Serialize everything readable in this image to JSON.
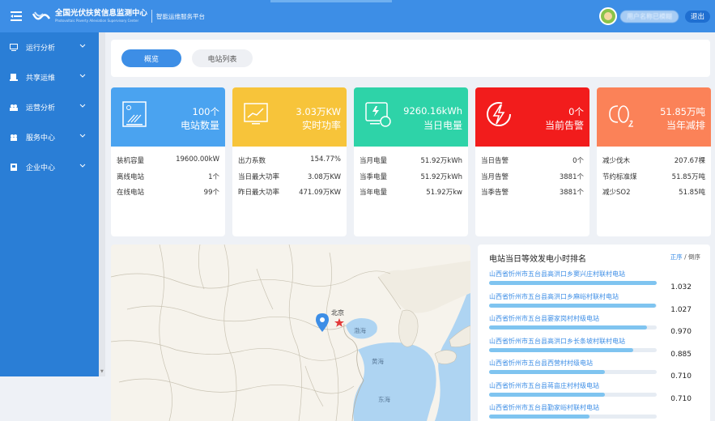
{
  "header": {
    "brand_cn": "全国光伏扶贫信息监测中心",
    "brand_en": "Photovoltaic Poverty Alleviation Supervisory Center",
    "sub_brand": "智能运维服务平台",
    "username": "用户名称已模糊",
    "logout_label": "退出"
  },
  "sidebar": {
    "items": [
      {
        "label": "运行分析",
        "icon": "monitor-icon"
      },
      {
        "label": "共享运维",
        "icon": "device-icon"
      },
      {
        "label": "运营分析",
        "icon": "group-icon"
      },
      {
        "label": "服务中心",
        "icon": "service-icon"
      },
      {
        "label": "企业中心",
        "icon": "building-icon"
      }
    ]
  },
  "tabs": [
    {
      "label": "概览",
      "active": true
    },
    {
      "label": "电站列表",
      "active": false
    }
  ],
  "cards": [
    {
      "color": "#4aa3f0",
      "icon": "solar-panel-icon",
      "value": "100个",
      "label": "电站数量",
      "rows": [
        {
          "k": "装机容量",
          "v": "19600.00kW"
        },
        {
          "k": "离线电站",
          "v": "1个"
        },
        {
          "k": "在线电站",
          "v": "99个"
        }
      ]
    },
    {
      "color": "#f7c43a",
      "icon": "line-chart-icon",
      "value": "3.03万KW",
      "label": "实时功率",
      "rows": [
        {
          "k": "出力系数",
          "v": "154.77%"
        },
        {
          "k": "当日最大功率",
          "v": "3.08万KW"
        },
        {
          "k": "昨日最大功率",
          "v": "471.09万KW"
        }
      ]
    },
    {
      "color": "#2ed3a8",
      "icon": "energy-meter-icon",
      "value": "9260.16kWh",
      "label": "当日电量",
      "rows": [
        {
          "k": "当月电量",
          "v": "51.92万kWh"
        },
        {
          "k": "当季电量",
          "v": "51.92万kWh"
        },
        {
          "k": "当年电量",
          "v": "51.92万kw"
        }
      ]
    },
    {
      "color": "#f21c1c",
      "icon": "lightning-alarm-icon",
      "value": "0个",
      "label": "当前告警",
      "rows": [
        {
          "k": "当日告警",
          "v": "0个"
        },
        {
          "k": "当月告警",
          "v": "3881个"
        },
        {
          "k": "当季告警",
          "v": "3881个"
        }
      ]
    },
    {
      "color": "#fb8258",
      "icon": "co2-icon",
      "value": "51.85万吨",
      "label": "当年减排",
      "rows": [
        {
          "k": "减少伐木",
          "v": "207.67棵"
        },
        {
          "k": "节约标准煤",
          "v": "51.85万吨"
        },
        {
          "k": "减少SO2",
          "v": "51.85吨"
        }
      ]
    }
  ],
  "map": {
    "labels": {
      "beijing": "北京",
      "bohai": "渤海",
      "yellow_sea": "黄海",
      "east_sea": "东海"
    }
  },
  "ranking": {
    "title": "电站当日等效发电小时排名",
    "sort_asc": "正序",
    "sort_sep": "/",
    "sort_desc": "倒序",
    "items": [
      {
        "name": "山西省忻州市五台县高洪口乡窦兴庄村联村电站",
        "value": "1.032",
        "ratio": 1.0
      },
      {
        "name": "山西省忻州市五台县高洪口乡麻峪村联村电站",
        "value": "1.027",
        "ratio": 0.995
      },
      {
        "name": "山西省忻州市五台县窭家岗村村级电站",
        "value": "0.970",
        "ratio": 0.94
      },
      {
        "name": "山西省忻州市五台县高洪口乡长条坡村联村电站",
        "value": "0.885",
        "ratio": 0.86
      },
      {
        "name": "山西省忻州市五台县西营村村级电站",
        "value": "0.710",
        "ratio": 0.69
      },
      {
        "name": "山西省忻州市五台县蒋亩庄村村级电站",
        "value": "0.710",
        "ratio": 0.69
      },
      {
        "name": "山西省忻州市五台县勤家峪村联村电站",
        "value": "",
        "ratio": 0.6
      }
    ]
  }
}
